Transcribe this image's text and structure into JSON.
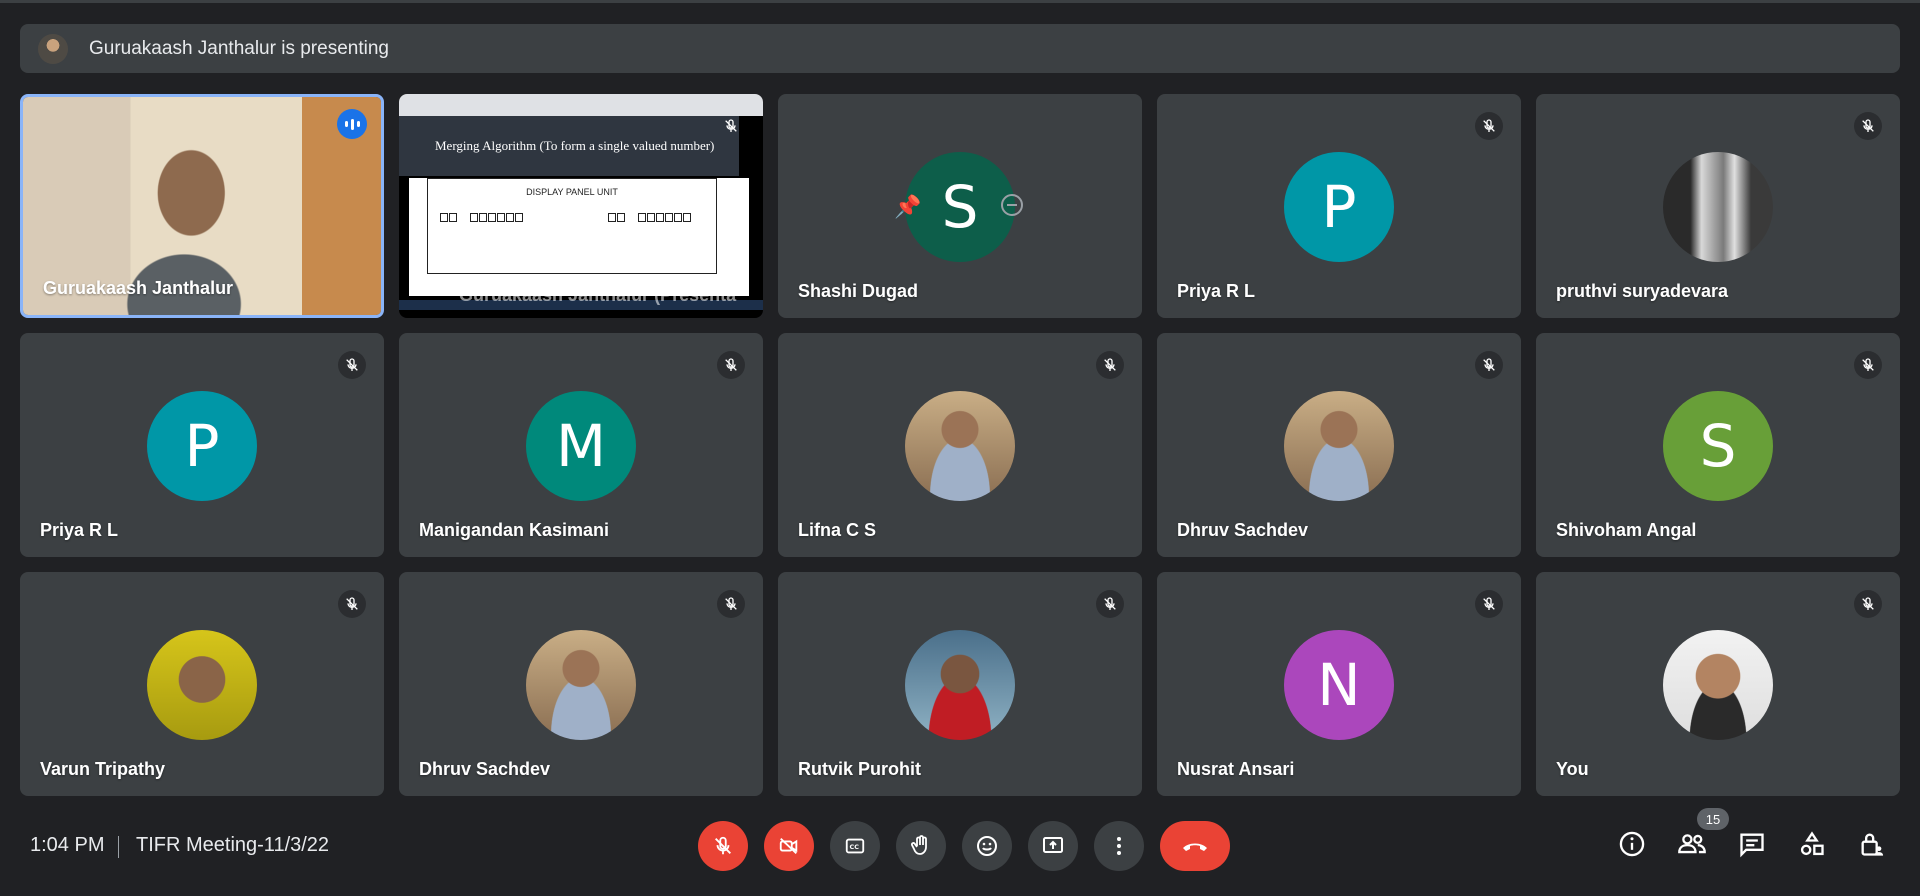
{
  "banner": {
    "text": "Guruakaash Janthalur is presenting"
  },
  "speaker": {
    "name": "Guruakaash Janthalur"
  },
  "share": {
    "slide_title": "Merging Algorithm (To form a single valued number)",
    "panel_label": "DISPLAY PANEL UNIT",
    "caption": "Guruakaash Janthalur (Presenta"
  },
  "tiles": [
    {
      "name": "Shashi Dugad",
      "initial": "S",
      "color": "#0d5e4a"
    },
    {
      "name": "Priya R L",
      "initial": "P",
      "color": "#0097a7"
    },
    {
      "name": "pruthvi suryadevara",
      "photo": "waterfall"
    },
    {
      "name": "Priya R L",
      "initial": "P",
      "color": "#0097a7"
    },
    {
      "name": "Manigandan Kasimani",
      "initial": "M",
      "color": "#00897b"
    },
    {
      "name": "Lifna C S",
      "photo": "person"
    },
    {
      "name": "Dhruv Sachdev",
      "photo": "person"
    },
    {
      "name": "Shivoham Angal",
      "initial": "S",
      "color": "#689f38"
    },
    {
      "name": "Varun Tripathy",
      "photo": "person-yellow"
    },
    {
      "name": "Dhruv Sachdev",
      "photo": "person"
    },
    {
      "name": "Rutvik Purohit",
      "photo": "person-red"
    },
    {
      "name": "Nusrat Ansari",
      "initial": "N",
      "color": "#ab47bc"
    },
    {
      "name": "You",
      "photo": "person-white"
    }
  ],
  "bottom": {
    "time": "1:04 PM",
    "meeting": "TIFR Meeting-11/3/22",
    "participants_count": "15"
  },
  "colors": {
    "accent": "#8ab4f8",
    "end_call": "#ea4335",
    "background": "#202124",
    "tile": "#3c4043"
  }
}
